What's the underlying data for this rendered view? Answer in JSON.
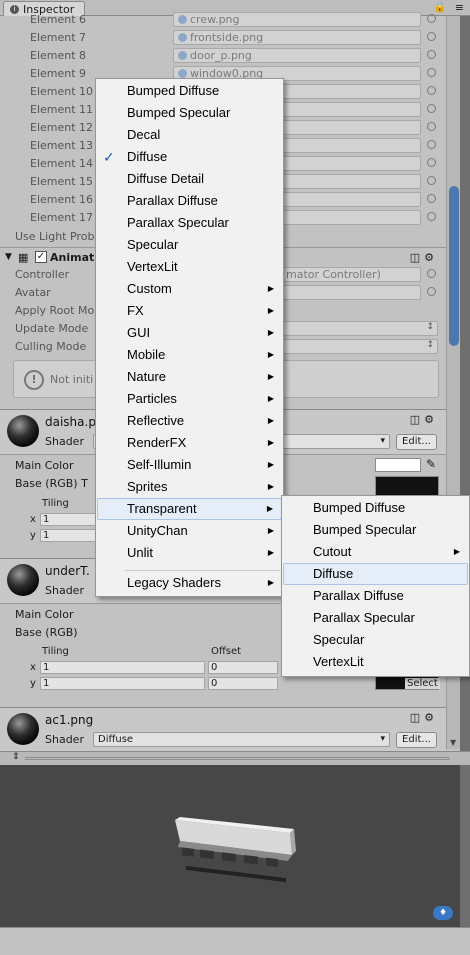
{
  "window": {
    "tab_label": "Inspector",
    "lock_icon": "lock-icon",
    "menu_icon": "window-menu-icon"
  },
  "elements": [
    {
      "label": "Element 6",
      "value": "crew.png"
    },
    {
      "label": "Element 7",
      "value": "frontside.png"
    },
    {
      "label": "Element 8",
      "value": "door_p.png"
    },
    {
      "label": "Element 9",
      "value": "window0.png"
    },
    {
      "label": "Element 10",
      "value": ""
    },
    {
      "label": "Element 11",
      "value": ""
    },
    {
      "label": "Element 12",
      "value": ""
    },
    {
      "label": "Element 13",
      "value": ""
    },
    {
      "label": "Element 14",
      "value": ""
    },
    {
      "label": "Element 15",
      "value": ""
    },
    {
      "label": "Element 16",
      "value": ""
    },
    {
      "label": "Element 17",
      "value": ""
    }
  ],
  "use_light_probes_label": "Use Light Prob",
  "animator": {
    "title": "Animat",
    "checkbox": "✓",
    "rows": [
      {
        "label": "Controller",
        "value": "mator Controller)"
      },
      {
        "label": "Avatar",
        "value": ""
      },
      {
        "label": "Apply Root Mo",
        "value": ""
      },
      {
        "label": "Update Mode",
        "value": ""
      },
      {
        "label": "Culling Mode",
        "value": ""
      }
    ],
    "help_text": "Not initi"
  },
  "materials": [
    {
      "name": "daisha.p",
      "shader_label": "Shader",
      "shader": "",
      "edit": "Edit..."
    },
    {
      "name": "underT.",
      "shader_label": "Shader",
      "shader": "",
      "edit": "Edit..."
    },
    {
      "name": "ac1.png",
      "shader_label": "Shader",
      "shader": "Diffuse",
      "edit": "Edit..."
    }
  ],
  "mat1_props": {
    "main_color": "Main Color",
    "base": "Base (RGB) T",
    "tiling": "Tiling",
    "x": "x",
    "y": "y",
    "tx": "1",
    "ty": "1"
  },
  "mat2_props": {
    "main_color": "Main Color",
    "base": "Base (RGB)",
    "tiling": "Tiling",
    "offset": "Offset",
    "x": "x",
    "y": "y",
    "tx": "1",
    "ty": "1",
    "ox": "0",
    "oy": "0",
    "select": "Select"
  },
  "main_menu": [
    {
      "label": "Bumped Diffuse",
      "submenu": false,
      "checked": false
    },
    {
      "label": "Bumped Specular",
      "submenu": false,
      "checked": false
    },
    {
      "label": "Decal",
      "submenu": false,
      "checked": false
    },
    {
      "label": "Diffuse",
      "submenu": false,
      "checked": true
    },
    {
      "label": "Diffuse Detail",
      "submenu": false,
      "checked": false
    },
    {
      "label": "Parallax Diffuse",
      "submenu": false,
      "checked": false
    },
    {
      "label": "Parallax Specular",
      "submenu": false,
      "checked": false
    },
    {
      "label": "Specular",
      "submenu": false,
      "checked": false
    },
    {
      "label": "VertexLit",
      "submenu": false,
      "checked": false
    },
    {
      "label": "Custom",
      "submenu": true,
      "checked": false
    },
    {
      "label": "FX",
      "submenu": true,
      "checked": false
    },
    {
      "label": "GUI",
      "submenu": true,
      "checked": false
    },
    {
      "label": "Mobile",
      "submenu": true,
      "checked": false
    },
    {
      "label": "Nature",
      "submenu": true,
      "checked": false
    },
    {
      "label": "Particles",
      "submenu": true,
      "checked": false
    },
    {
      "label": "Reflective",
      "submenu": true,
      "checked": false
    },
    {
      "label": "RenderFX",
      "submenu": true,
      "checked": false
    },
    {
      "label": "Self-Illumin",
      "submenu": true,
      "checked": false
    },
    {
      "label": "Sprites",
      "submenu": true,
      "checked": false
    },
    {
      "label": "Transparent",
      "submenu": true,
      "checked": false,
      "highlighted": true
    },
    {
      "label": "UnityChan",
      "submenu": true,
      "checked": false
    },
    {
      "label": "Unlit",
      "submenu": true,
      "checked": false
    },
    {
      "label": "Legacy Shaders",
      "submenu": true,
      "checked": false
    }
  ],
  "sub_menu": [
    {
      "label": "Bumped Diffuse",
      "submenu": false
    },
    {
      "label": "Bumped Specular",
      "submenu": false
    },
    {
      "label": "Cutout",
      "submenu": true
    },
    {
      "label": "Diffuse",
      "submenu": false,
      "highlighted": true
    },
    {
      "label": "Parallax Diffuse",
      "submenu": false
    },
    {
      "label": "Parallax Specular",
      "submenu": false
    },
    {
      "label": "Specular",
      "submenu": false
    },
    {
      "label": "VertexLit",
      "submenu": false
    }
  ],
  "colors": {
    "highlight": "#e5eef8",
    "check": "#1c5ab0",
    "scroll_thumb": "#4b78ad",
    "preview_bg": "#474747"
  }
}
